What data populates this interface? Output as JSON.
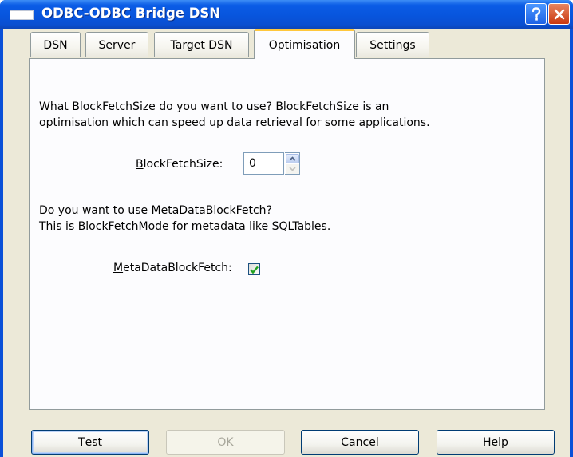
{
  "window": {
    "title": "ODBC-ODBC Bridge DSN"
  },
  "titlebar_buttons": {
    "help_icon": "question-mark",
    "close_icon": "x-mark"
  },
  "tabs": [
    {
      "label": "DSN",
      "active": false
    },
    {
      "label": "Server",
      "active": false
    },
    {
      "label": "Target DSN",
      "active": false
    },
    {
      "label": "Optimisation",
      "active": true
    },
    {
      "label": "Settings",
      "active": false
    }
  ],
  "optimisation": {
    "block_fetch_desc_line1": "What BlockFetchSize do you want to use? BlockFetchSize is an",
    "block_fetch_desc_line2": "optimisation which can speed up data retrieval for some applications.",
    "block_fetch_label_mnemonic": "B",
    "block_fetch_label_rest": "lockFetchSize:",
    "block_fetch_value": "0",
    "metadata_desc_line1": "Do you want to use MetaDataBlockFetch?",
    "metadata_desc_line2": "This is BlockFetchMode for metadata like SQLTables.",
    "metadata_label_mnemonic": "M",
    "metadata_label_rest": "etaDataBlockFetch:",
    "metadata_checked": true
  },
  "buttons": {
    "test_mnemonic": "T",
    "test_rest": "est",
    "ok": "OK",
    "cancel": "Cancel",
    "help": "Help"
  },
  "colors": {
    "titlebar": "#0a50d8",
    "dialog_face": "#ece9d8",
    "active_tab_accent": "#ffc73c",
    "check_mark": "#21a121",
    "close_button": "#c9380f"
  }
}
